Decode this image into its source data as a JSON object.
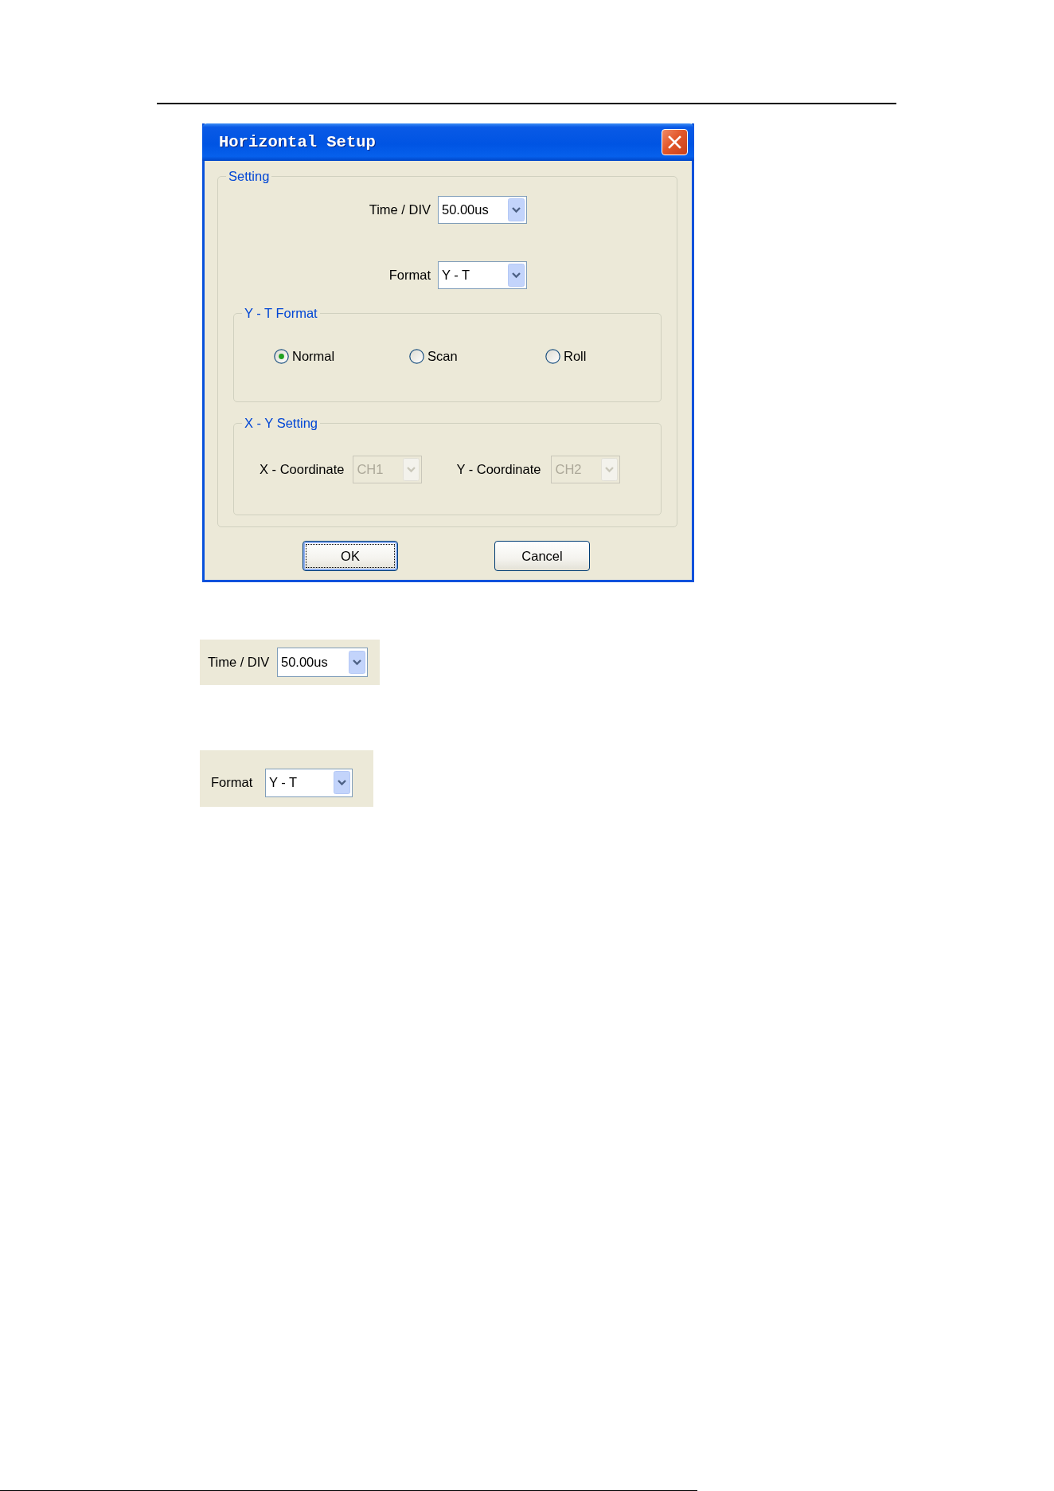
{
  "dialog": {
    "title": "Horizontal Setup",
    "setting": {
      "title": "Setting",
      "fields": [
        {
          "label": "Time / DIV",
          "value": "50.00us",
          "disabled": false
        },
        {
          "label": "Format",
          "value": "Y - T",
          "disabled": false
        }
      ]
    },
    "yt_format": {
      "title": "Y - T Format",
      "options": [
        {
          "label": "Normal",
          "selected": true
        },
        {
          "label": "Scan",
          "selected": false
        },
        {
          "label": "Roll",
          "selected": false
        }
      ]
    },
    "xy_setting": {
      "title": "X - Y Setting",
      "fields": [
        {
          "label": "X - Coordinate",
          "value": "CH1",
          "disabled": true
        },
        {
          "label": "Y - Coordinate",
          "value": "CH2",
          "disabled": true
        }
      ]
    },
    "buttons": [
      {
        "label": "OK",
        "focused": true
      },
      {
        "label": "Cancel",
        "focused": false
      }
    ]
  },
  "snippets": [
    {
      "label": "Time / DIV",
      "value": "50.00us"
    },
    {
      "label": "Format",
      "value": "Y - T"
    }
  ]
}
